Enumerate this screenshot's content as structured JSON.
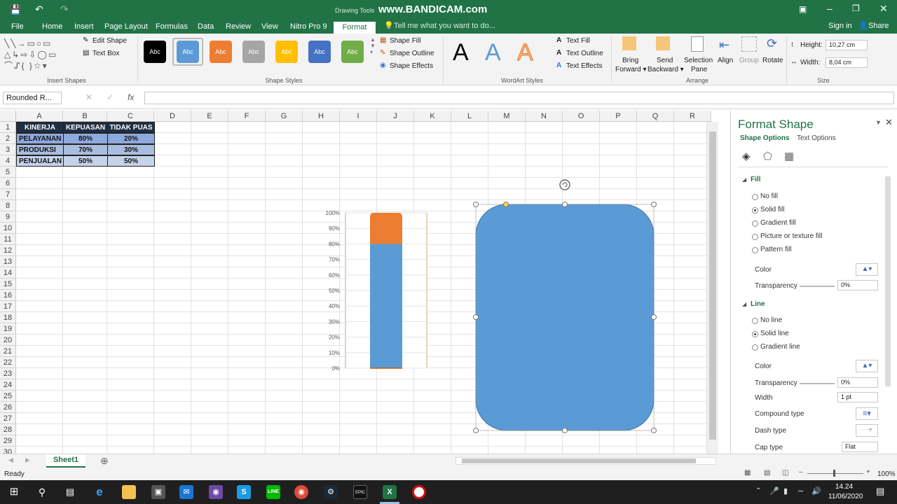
{
  "titlebar": {
    "drawing_tools": "Drawing Tools",
    "watermark": "www.BANDICAM.com",
    "sign_in": "Sign in",
    "share": "Share"
  },
  "tabs": [
    "File",
    "Home",
    "Insert",
    "Page Layout",
    "Formulas",
    "Data",
    "Review",
    "View",
    "Nitro Pro 9",
    "Format"
  ],
  "tell_me": "Tell me what you want to do...",
  "ribbon": {
    "insert_shapes": {
      "label": "Insert Shapes",
      "edit_shape": "Edit Shape",
      "text_box": "Text Box"
    },
    "shape_styles": {
      "label": "Shape Styles",
      "swatch_text": "Abc",
      "swatch_colors": [
        "#000000",
        "#5b9bd5",
        "#ed7d31",
        "#a5a5a5",
        "#ffc000",
        "#4472c4",
        "#70ad47"
      ],
      "fill": "Shape Fill",
      "outline": "Shape Outline",
      "effects": "Shape Effects"
    },
    "wordart": {
      "label": "WordArt Styles",
      "letter": "A",
      "text_fill": "Text Fill",
      "text_outline": "Text Outline",
      "text_effects": "Text Effects"
    },
    "arrange": {
      "label": "Arrange",
      "bring_forward": "Bring Forward",
      "send_backward": "Send Backward",
      "selection_pane": "Selection Pane",
      "align": "Align",
      "group": "Group",
      "rotate": "Rotate"
    },
    "size": {
      "label": "Size",
      "height_label": "Height:",
      "height": "10,27 cm",
      "width_label": "Width:",
      "width": "8,04 cm"
    }
  },
  "formula_bar": {
    "name_box": "Rounded R...",
    "fx": "fx",
    "value": ""
  },
  "grid": {
    "columns": [
      "A",
      "B",
      "C",
      "D",
      "E",
      "F",
      "G",
      "H",
      "I",
      "J",
      "K",
      "L",
      "M",
      "N",
      "O",
      "P",
      "Q",
      "R"
    ],
    "rows": [
      "1",
      "2",
      "3",
      "4",
      "5",
      "6",
      "7",
      "8",
      "9",
      "10",
      "11",
      "12",
      "13",
      "14",
      "15",
      "16",
      "17",
      "18",
      "19",
      "20",
      "21",
      "22",
      "23",
      "24",
      "25",
      "26",
      "27",
      "28",
      "29",
      "30"
    ],
    "table": {
      "header": [
        "KINERJA",
        "KEPUASAN",
        "TIDAK PUAS"
      ],
      "rows": [
        [
          "PELAYANAN",
          "80%",
          "20%"
        ],
        [
          "PRODUKSI",
          "70%",
          "30%"
        ],
        [
          "PENJUALAN",
          "50%",
          "50%"
        ]
      ]
    }
  },
  "chart_data": {
    "type": "bar",
    "stacked": true,
    "categories": [
      ""
    ],
    "series": [
      {
        "values": [
          80
        ],
        "color": "#5b9bd5"
      },
      {
        "values": [
          20
        ],
        "color": "#ed7d31"
      }
    ],
    "yticks": [
      "0%",
      "10%",
      "20%",
      "30%",
      "40%",
      "50%",
      "60%",
      "70%",
      "80%",
      "90%",
      "100%"
    ],
    "ylim": [
      0,
      100
    ],
    "title": "",
    "xlabel": "",
    "ylabel": ""
  },
  "shape": {
    "fill": "#5b9bd5"
  },
  "pane": {
    "title": "Format Shape",
    "tab_shape": "Shape Options",
    "tab_text": "Text Options",
    "fill_section": "Fill",
    "fill_options": [
      "No fill",
      "Solid fill",
      "Gradient fill",
      "Picture or texture fill",
      "Pattern fill"
    ],
    "color_label": "Color",
    "transparency_label": "Transparency",
    "transparency": "0%",
    "line_section": "Line",
    "line_options": [
      "No line",
      "Solid line",
      "Gradient line"
    ],
    "line_color_label": "Color",
    "line_transparency_label": "Transparency",
    "line_transparency": "0%",
    "width_label": "Width",
    "width": "1 pt",
    "compound_label": "Compound type",
    "dash_label": "Dash type",
    "cap_label": "Cap type",
    "cap": "Flat"
  },
  "sheet_tab": "Sheet1",
  "status": {
    "ready": "Ready",
    "zoom": "100%"
  },
  "taskbar": {
    "time": "14.24",
    "date": "11/06/2020"
  }
}
